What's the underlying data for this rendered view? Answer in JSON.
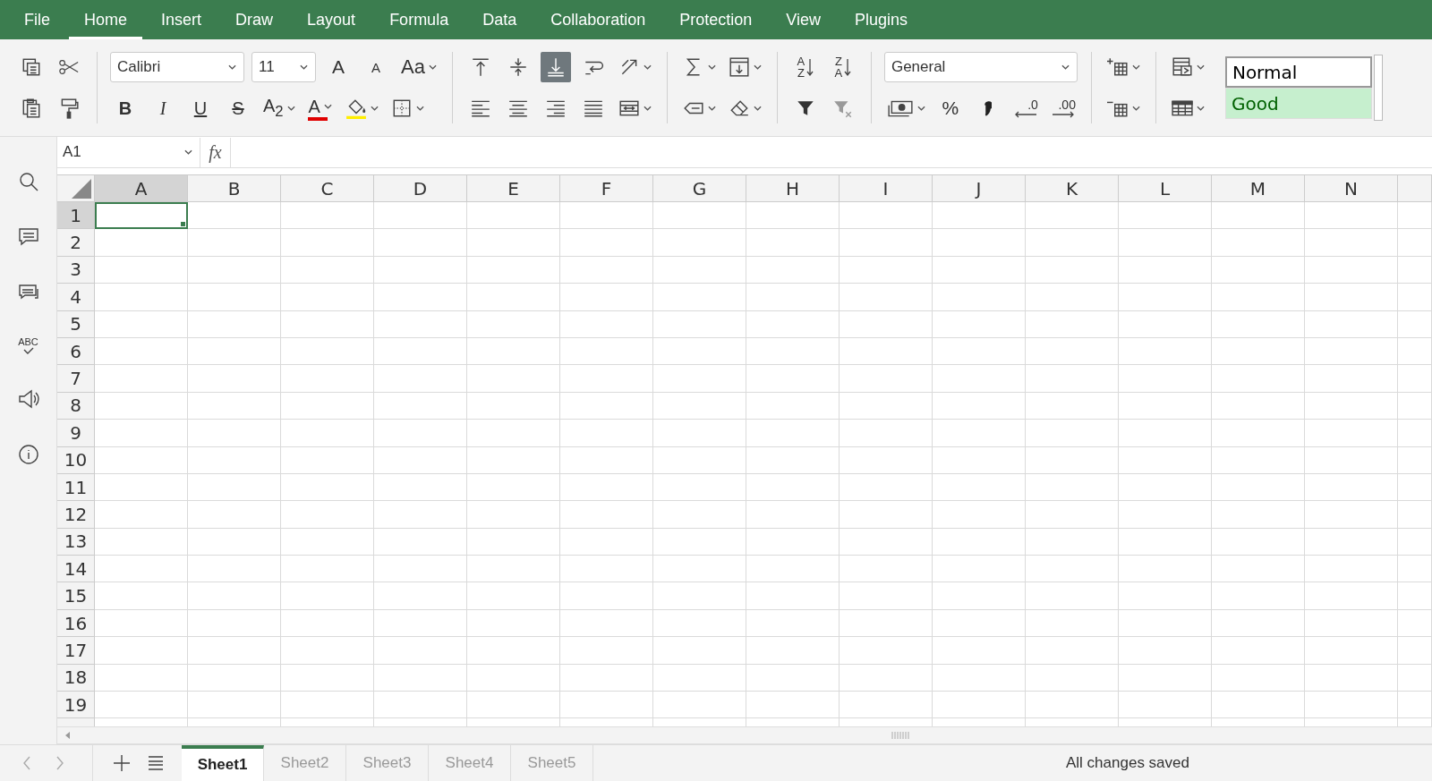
{
  "menu": [
    {
      "label": "File",
      "selected": false
    },
    {
      "label": "Home",
      "selected": true
    },
    {
      "label": "Insert",
      "selected": false
    },
    {
      "label": "Draw",
      "selected": false
    },
    {
      "label": "Layout",
      "selected": false
    },
    {
      "label": "Formula",
      "selected": false
    },
    {
      "label": "Data",
      "selected": false
    },
    {
      "label": "Collaboration",
      "selected": false
    },
    {
      "label": "Protection",
      "selected": false
    },
    {
      "label": "View",
      "selected": false
    },
    {
      "label": "Plugins",
      "selected": false
    }
  ],
  "toolbar": {
    "font": "Calibri",
    "font_size": "11",
    "grow_font": "A",
    "shrink_font": "A",
    "change_case": "Aa",
    "bold": "B",
    "italic": "I",
    "underline": "U",
    "strikethrough": "S",
    "subscript": "A$_{2}$",
    "font_color": "A",
    "vertical_align": [
      {
        "selected": false
      },
      {
        "selected": false
      },
      {
        "selected": true
      }
    ],
    "sort_ascending": [
      "A",
      "Z"
    ],
    "sort_descending": [
      "Z",
      "A"
    ],
    "number_format": "General",
    "percent": "%",
    "decrease_decimal": ".0",
    "increase_decimal": ".00",
    "styles": [
      {
        "label": "Normal",
        "kind": "normal"
      },
      {
        "label": "Good",
        "kind": "good"
      }
    ]
  },
  "formula_bar": {
    "name_box": "A1",
    "fx": "fx"
  },
  "sidebar": {
    "spellcheck": "ABC"
  },
  "grid": {
    "columns": [
      {
        "label": "A",
        "selected": true
      },
      {
        "label": "B",
        "selected": false
      },
      {
        "label": "C",
        "selected": false
      },
      {
        "label": "D",
        "selected": false
      },
      {
        "label": "E",
        "selected": false
      },
      {
        "label": "F",
        "selected": false
      },
      {
        "label": "G",
        "selected": false
      },
      {
        "label": "H",
        "selected": false
      },
      {
        "label": "I",
        "selected": false
      },
      {
        "label": "J",
        "selected": false
      },
      {
        "label": "K",
        "selected": false
      },
      {
        "label": "L",
        "selected": false
      },
      {
        "label": "M",
        "selected": false
      },
      {
        "label": "N",
        "selected": false
      }
    ],
    "rows": [
      {
        "label": "1",
        "selected": true
      },
      {
        "label": "2",
        "selected": false
      },
      {
        "label": "3",
        "selected": false
      },
      {
        "label": "4",
        "selected": false
      },
      {
        "label": "5",
        "selected": false
      },
      {
        "label": "6",
        "selected": false
      },
      {
        "label": "7",
        "selected": false
      },
      {
        "label": "8",
        "selected": false
      },
      {
        "label": "9",
        "selected": false
      },
      {
        "label": "10",
        "selected": false
      },
      {
        "label": "11",
        "selected": false
      },
      {
        "label": "12",
        "selected": false
      },
      {
        "label": "13",
        "selected": false
      },
      {
        "label": "14",
        "selected": false
      },
      {
        "label": "15",
        "selected": false
      },
      {
        "label": "16",
        "selected": false
      },
      {
        "label": "17",
        "selected": false
      },
      {
        "label": "18",
        "selected": false
      },
      {
        "label": "19",
        "selected": false
      }
    ]
  },
  "sheets": [
    {
      "label": "Sheet1",
      "selected": true
    },
    {
      "label": "Sheet2",
      "selected": false
    },
    {
      "label": "Sheet3",
      "selected": false
    },
    {
      "label": "Sheet4",
      "selected": false
    },
    {
      "label": "Sheet5",
      "selected": false
    }
  ],
  "status": "All changes saved"
}
